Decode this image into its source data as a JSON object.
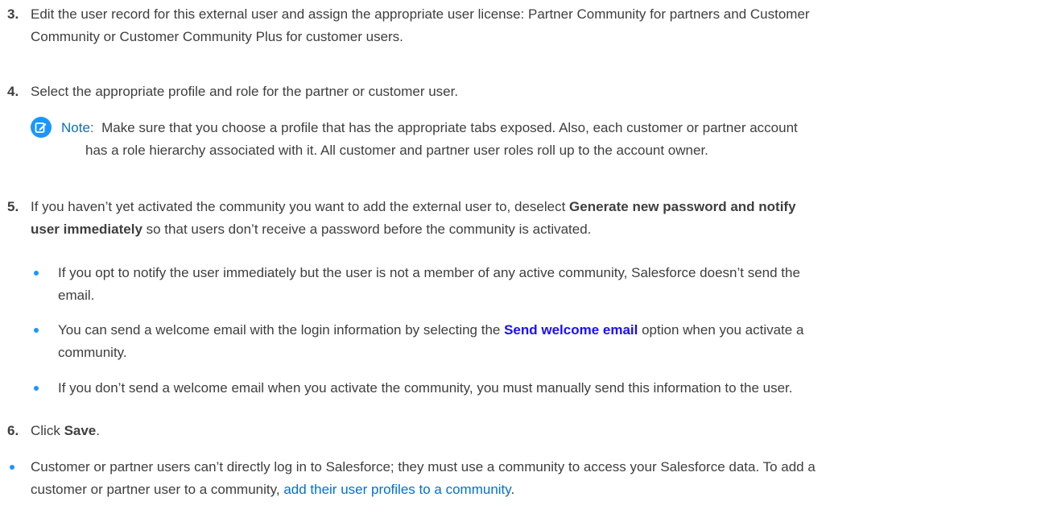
{
  "steps": {
    "s3": {
      "num": "3.",
      "line1": "Edit the user record for this external user and assign the appropriate user license: Partner Community for partners and Customer",
      "line2": "Community or Customer Community Plus for customer users."
    },
    "s4": {
      "num": "4.",
      "text": "Select the appropriate profile and role for the partner or customer user."
    },
    "note": {
      "label": "Note:",
      "line1": "Make sure that you choose a profile that has the appropriate tabs exposed. Also, each customer or partner account",
      "line2": "has a role hierarchy associated with it. All customer and partner user roles roll up to the account owner."
    },
    "s5": {
      "num": "5.",
      "line1_pre": "If you haven’t yet activated the community you want to add the external user to, deselect ",
      "line1_bold": "Generate new password and notify",
      "line2_bold": "user immediately",
      "line2_post": " so that users don’t receive a password before the community is activated.",
      "bullets": {
        "b1": {
          "line1": "If you opt to notify the user immediately but the user is not a member of any active community, Salesforce doesn’t send the",
          "line2": "email."
        },
        "b2": {
          "line1_pre": "You can send a welcome email with the login information by selecting the ",
          "line1_link": "Send welcome email",
          "line1_post": " option when you activate a",
          "line2": "community."
        },
        "b3": {
          "line1": "If you don’t send a welcome email when you activate the community, you must manually send this information to the user."
        }
      }
    },
    "s6": {
      "num": "6.",
      "pre": "Click ",
      "bold": "Save",
      "post": "."
    }
  },
  "footer_bullet": {
    "line1": "Customer or partner users can’t directly log in to Salesforce; they must use a community to access your Salesforce data. To add a",
    "line2_pre": "customer or partner user to a community, ",
    "line2_link": "add their user profiles to a community",
    "line2_post": "."
  },
  "colors": {
    "text": "#3e3e3c",
    "bullet": "#1b96ff",
    "note_icon": "#1b96ff",
    "link": "#0070d2",
    "strong_link": "#1a0dff"
  },
  "icons": {
    "note": "note-edit-icon"
  }
}
